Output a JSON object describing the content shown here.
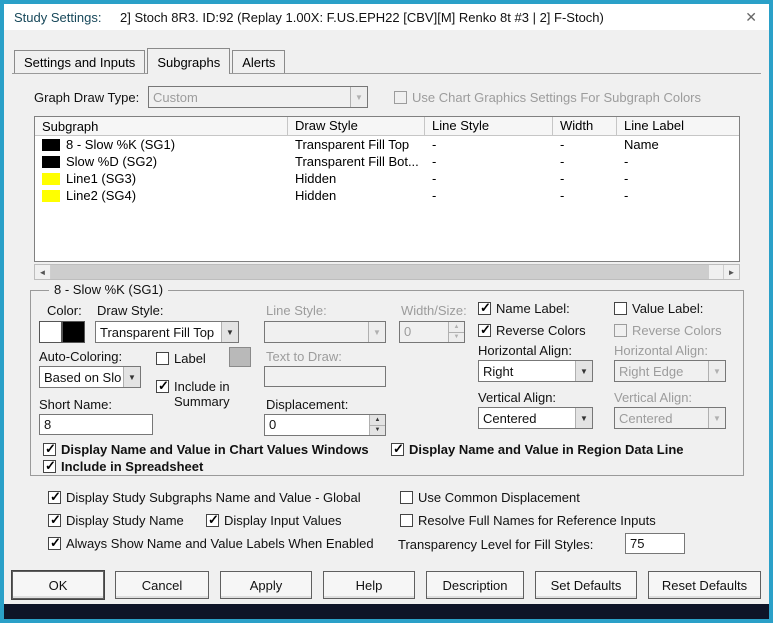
{
  "icons": {
    "chevron_down": "▼",
    "spin_up": "▲",
    "spin_down": "▼",
    "scroll_left": "◄",
    "scroll_right": "►",
    "close": "✕"
  },
  "window": {
    "title": "Study Settings:",
    "subtitle": "2] Stoch 8R3. ID:92 (Replay 1.00X: F.US.EPH22 [CBV][M]  Renko 8t  #3 | 2] F-Stoch)",
    "frame_color": "#2aa0c8"
  },
  "tabs": [
    {
      "label": "Settings and Inputs"
    },
    {
      "label": "Subgraphs"
    },
    {
      "label": "Alerts"
    }
  ],
  "active_tab": "Subgraphs",
  "draw_type": {
    "label": "Graph Draw Type:",
    "value": "Custom",
    "chart_graphics": {
      "label": "Use Chart Graphics Settings For Subgraph Colors",
      "checked": false
    }
  },
  "subgraph_table": {
    "headers": [
      "Subgraph",
      "Draw Style",
      "Line Style",
      "Width",
      "Line Label"
    ],
    "rows": [
      {
        "swatch": "#000000",
        "name": "8 - Slow %K (SG1)",
        "draw_style": "Transparent Fill Top",
        "line_style": "-",
        "width": "-",
        "line_label": "Name"
      },
      {
        "swatch": "#000000",
        "name": "Slow %D (SG2)",
        "draw_style": "Transparent Fill Bot...",
        "line_style": "-",
        "width": "-",
        "line_label": "-"
      },
      {
        "swatch": "#ffff00",
        "name": "Line1 (SG3)",
        "draw_style": "Hidden",
        "line_style": "-",
        "width": "-",
        "line_label": "-"
      },
      {
        "swatch": "#ffff00",
        "name": "Line2 (SG4)",
        "draw_style": "Hidden",
        "line_style": "-",
        "width": "-",
        "line_label": "-"
      }
    ]
  },
  "detail": {
    "title": "8 - Slow %K (SG1)",
    "color": {
      "label": "Color:",
      "primary": "#ffffff",
      "secondary": "#000000"
    },
    "draw_style": {
      "label": "Draw Style:",
      "value": "Transparent Fill Top"
    },
    "line_style": {
      "label": "Line Style:",
      "value": ""
    },
    "width_size": {
      "label": "Width/Size:",
      "value": "0"
    },
    "auto_coloring": {
      "label": "Auto-Coloring:",
      "value": "Based on Slo"
    },
    "label_cb": {
      "label": "Label",
      "checked": false
    },
    "text_to_draw": {
      "label": "Text to Draw:",
      "value": ""
    },
    "include_summary": {
      "label": "Include in Summary",
      "checked": true
    },
    "short_name": {
      "label": "Short Name:",
      "value": "8"
    },
    "displacement": {
      "label": "Displacement:",
      "value": "0"
    },
    "name_label": {
      "label": "Name Label:",
      "checked": true
    },
    "value_label": {
      "label": "Value Label:",
      "checked": false
    },
    "reverse_colors": {
      "label": "Reverse Colors",
      "checked": true
    },
    "reverse_colors_right": {
      "label": "Reverse Colors",
      "checked": false
    },
    "h_align_left": {
      "label": "Horizontal Align:",
      "value": "Right"
    },
    "v_align_left": {
      "label": "Vertical Align:",
      "value": "Centered"
    },
    "h_align_right": {
      "label": "Horizontal Align:",
      "value": "Right Edge"
    },
    "v_align_right": {
      "label": "Vertical Align:",
      "value": "Centered"
    },
    "display_chart_values": {
      "label": "Display Name and Value in Chart Values Windows",
      "checked": true
    },
    "display_region_line": {
      "label": "Display Name and Value in Region Data Line",
      "checked": true
    },
    "include_spreadsheet": {
      "label": "Include in Spreadsheet",
      "checked": true
    }
  },
  "options": {
    "subgraphs_global": {
      "label": "Display Study Subgraphs Name and Value - Global",
      "checked": true
    },
    "common_displacement": {
      "label": "Use Common Displacement",
      "checked": false
    },
    "display_study_name": {
      "label": "Display Study Name",
      "checked": true
    },
    "display_input_values": {
      "label": "Display Input Values",
      "checked": true
    },
    "resolve_full_names": {
      "label": "Resolve Full Names for Reference Inputs",
      "checked": false
    },
    "always_show_labels": {
      "label": "Always Show Name and Value Labels When Enabled",
      "checked": true
    },
    "transparency": {
      "label": "Transparency Level for Fill Styles:",
      "value": "75"
    }
  },
  "buttons": [
    {
      "label": "OK"
    },
    {
      "label": "Cancel"
    },
    {
      "label": "Apply"
    },
    {
      "label": "Help"
    },
    {
      "label": "Description"
    },
    {
      "label": "Set Defaults"
    },
    {
      "label": "Reset Defaults"
    }
  ]
}
